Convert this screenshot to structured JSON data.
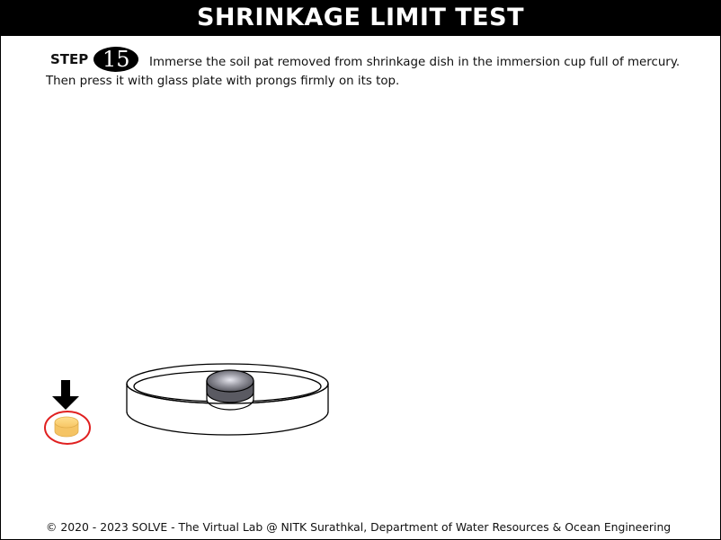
{
  "header": {
    "title": "SHRINKAGE LIMIT TEST"
  },
  "step": {
    "label": "STEP",
    "number": "15",
    "instruction_line1": "Immerse the soil pat removed from shrinkage dish in the immersion cup full of mercury.",
    "instruction_line2": "Then press it with glass plate with prongs firmly on its top."
  },
  "scene": {
    "objects": [
      {
        "name": "soil-pat",
        "clickable": true,
        "color": "#f5c96a",
        "highlight_color": "#e02020"
      },
      {
        "name": "down-arrow-icon",
        "color": "#000000"
      },
      {
        "name": "immersion-dish"
      },
      {
        "name": "mercury-cup",
        "color": "#7a7a7a"
      }
    ]
  },
  "footer": {
    "text": "© 2020 - 2023 SOLVE - The Virtual Lab @ NITK Surathkal, Department of Water Resources & Ocean Engineering"
  }
}
